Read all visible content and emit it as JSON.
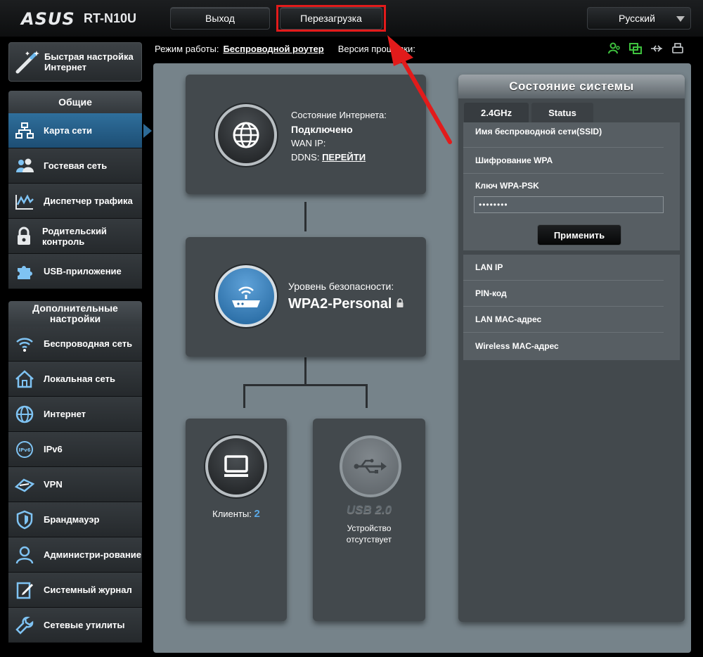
{
  "header": {
    "logo": "ASUS",
    "model": "RT-N10U",
    "logout_label": "Выход",
    "reboot_label": "Перезагрузка",
    "language": "Русский"
  },
  "infobar": {
    "mode_label": "Режим работы:",
    "mode_value": "Беспроводной роутер",
    "firmware_label": "Версия прошивки:"
  },
  "sidebar": {
    "quick_setup": "Быстрая настройка Интернет",
    "general_title": "Общие",
    "general_items": [
      {
        "label": "Карта сети",
        "icon": "network-map-icon"
      },
      {
        "label": "Гостевая сеть",
        "icon": "guest-network-icon"
      },
      {
        "label": "Диспетчер трафика",
        "icon": "traffic-manager-icon"
      },
      {
        "label": "Родительский контроль",
        "icon": "parental-control-icon"
      },
      {
        "label": "USB-приложение",
        "icon": "usb-app-icon"
      }
    ],
    "advanced_title": "Дополнительные настройки",
    "advanced_items": [
      {
        "label": "Беспроводная сеть",
        "icon": "wireless-icon"
      },
      {
        "label": "Локальная сеть",
        "icon": "lan-icon"
      },
      {
        "label": "Интернет",
        "icon": "internet-icon"
      },
      {
        "label": "IPv6",
        "icon": "ipv6-icon"
      },
      {
        "label": "VPN",
        "icon": "vpn-icon"
      },
      {
        "label": "Брандмауэр",
        "icon": "firewall-icon"
      },
      {
        "label": "Администри-рование",
        "icon": "administration-icon"
      },
      {
        "label": "Системный журнал",
        "icon": "system-log-icon"
      },
      {
        "label": "Сетевые утилиты",
        "icon": "network-tools-icon"
      }
    ]
  },
  "map": {
    "internet_status_label": "Состояние Интернета:",
    "internet_status_value": "Подключено",
    "wan_ip_label": "WAN IP:",
    "ddns_label": "DDNS:",
    "ddns_link": "ПЕРЕЙТИ",
    "security_label": "Уровень безопасности:",
    "security_value": "WPA2-Personal",
    "clients_label": "Клиенты:",
    "clients_count": "2",
    "usb_label": "USB 2.0",
    "usb_status": "Устройство отсутствует"
  },
  "system_status": {
    "title": "Состояние системы",
    "tabs": [
      "2.4GHz",
      "Status"
    ],
    "ssid_label": "Имя беспроводной сети(SSID)",
    "wpa_enc_label": "Шифрование WPA",
    "wpa_key_label": "Ключ WPA-PSK",
    "wpa_key_value": "••••••••",
    "apply_label": "Применить",
    "lan_ip_label": "LAN IP",
    "pin_label": "PIN-код",
    "lan_mac_label": "LAN MAC-адрес",
    "wireless_mac_label": "Wireless MAC-адрес"
  },
  "colors": {
    "annotation_red": "#e21b1b",
    "active_nav": "#2f6f9c",
    "status_green": "#3ec23e"
  }
}
